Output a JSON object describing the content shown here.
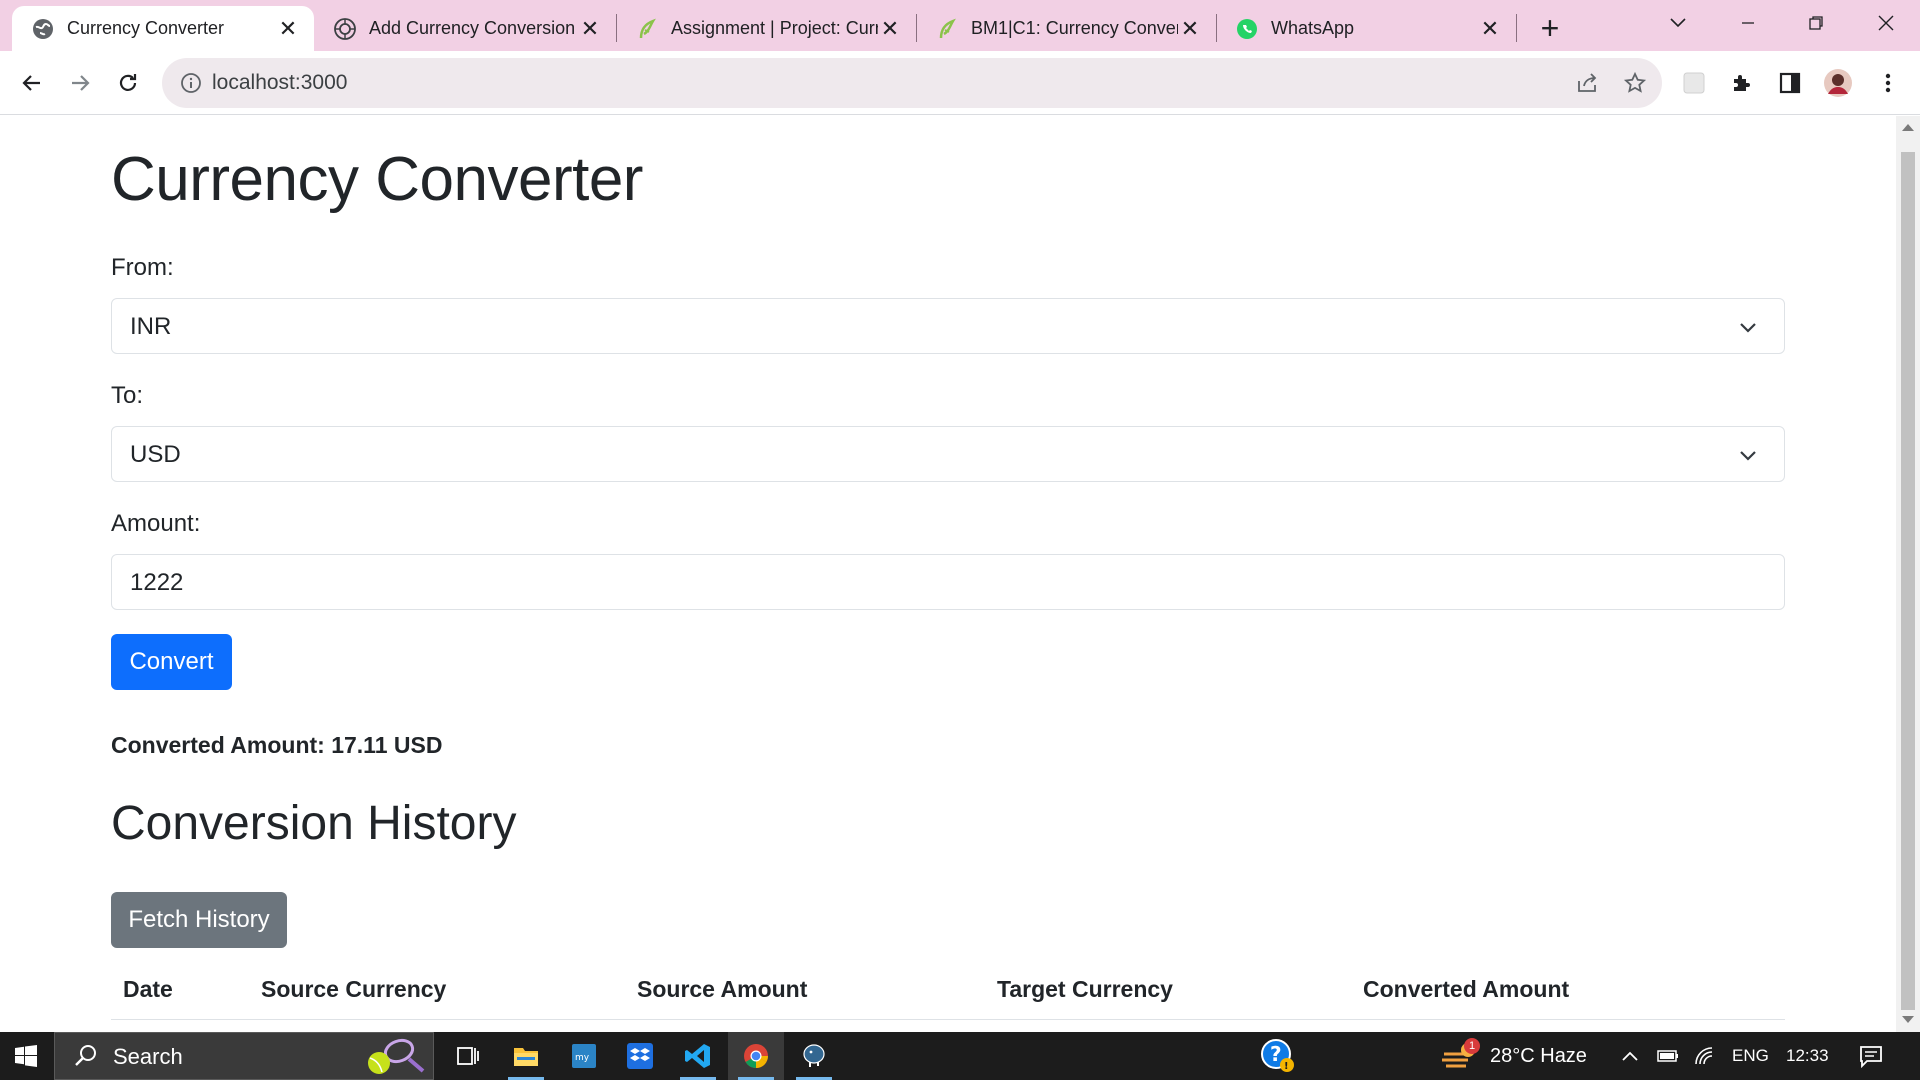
{
  "browser": {
    "tabs": [
      {
        "title": "Currency Converter",
        "icon": "globe-icon",
        "active": true
      },
      {
        "title": "Add Currency Conversion",
        "icon": "chatgpt-icon",
        "active": false
      },
      {
        "title": "Assignment | Project: Curr",
        "icon": "leaf-icon",
        "active": false
      },
      {
        "title": "BM1|C1: Currency Conver",
        "icon": "leaf-icon",
        "active": false
      },
      {
        "title": "WhatsApp",
        "icon": "whatsapp-icon",
        "active": false
      }
    ],
    "close_glyph": "✕",
    "new_tab_glyph": "+",
    "url": "localhost:3000"
  },
  "app": {
    "title": "Currency Converter",
    "from_label": "From:",
    "from_value": "INR",
    "to_label": "To:",
    "to_value": "USD",
    "amount_label": "Amount:",
    "amount_value": "1222",
    "convert_label": "Convert",
    "result_text": "Converted Amount: 17.11 USD",
    "history_title": "Conversion History",
    "fetch_label": "Fetch History",
    "columns": [
      "Date",
      "Source Currency",
      "Source Amount",
      "Target Currency",
      "Converted Amount"
    ]
  },
  "taskbar": {
    "search_placeholder": "Search",
    "weather": "28°C  Haze",
    "language": "ENG",
    "time": "12:33",
    "notification_badge": "1"
  },
  "colors": {
    "primary": "#0d6efd",
    "secondary": "#6c757d",
    "tabstrip": "#f2d0e4"
  }
}
